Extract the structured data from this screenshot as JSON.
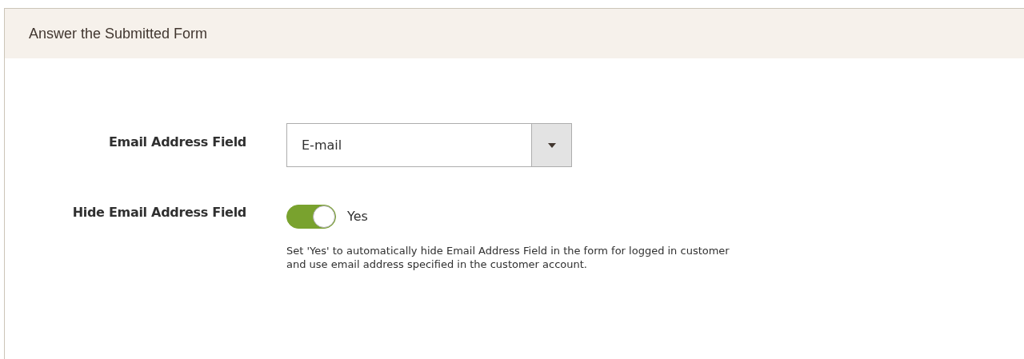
{
  "section": {
    "title": "Answer the Submitted Form"
  },
  "fields": [
    {
      "kind": "select",
      "label": "Email Address Field",
      "value": "E-mail"
    },
    {
      "kind": "toggle",
      "label": "Hide Email Address Field",
      "on": true,
      "state_label": "Yes",
      "note": "Set 'Yes' to automatically hide Email Address Field in the form for logged in customer and use email address specified in the customer account."
    }
  ]
}
